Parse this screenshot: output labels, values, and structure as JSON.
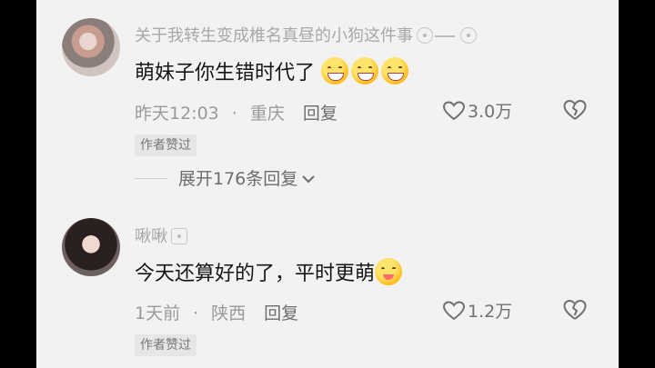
{
  "comments": [
    {
      "username": "关于我转生变成椎名真昼的小狗这件事",
      "text": "萌妹子你生错时代了",
      "emojis": [
        "grin-emoji",
        "grin-emoji",
        "grin-emoji"
      ],
      "time": "昨天12:03",
      "location": "重庆",
      "reply_label": "回复",
      "likes": "3.0万",
      "author_liked": "作者赞过",
      "expand_label": "展开176条回复"
    },
    {
      "username": "啾啾",
      "text": "今天还算好的了，平时更萌",
      "emojis": [
        "yum-emoji"
      ],
      "time": "1天前",
      "location": "陕西",
      "reply_label": "回复",
      "likes": "1.2万",
      "author_liked": "作者赞过"
    }
  ],
  "separator": "·",
  "colors": {
    "background": "#f2f2f2",
    "text": "#151515",
    "meta": "#9a9a9a"
  }
}
